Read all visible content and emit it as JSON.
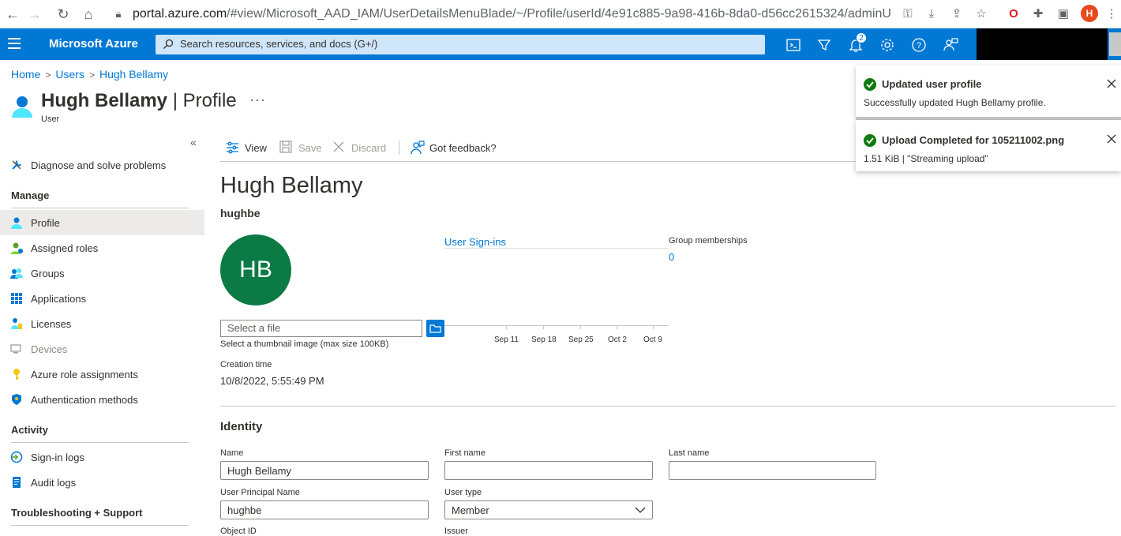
{
  "browser": {
    "url_host": "portal.azure.com",
    "url_path": "/#view/Microsoft_AAD_IAM/UserDetailsMenuBlade/~/Profile/userId/4e91c885-9a98-416b-8da0-d56cc2615324/adminUnitObj...",
    "profile_initial": "H"
  },
  "topbar": {
    "brand": "Microsoft Azure",
    "search_placeholder": "Search resources, services, and docs (G+/)",
    "notification_count": "2"
  },
  "breadcrumb": {
    "home": "Home",
    "users": "Users",
    "current": "Hugh Bellamy"
  },
  "header": {
    "title_bold": "Hugh Bellamy",
    "title_sep": " | ",
    "title_page": "Profile",
    "subtitle": "User",
    "more": "···"
  },
  "sidebar": {
    "collapse": "«",
    "diagnose": "Diagnose and solve problems",
    "manage_heading": "Manage",
    "manage_items": [
      "Profile",
      "Assigned roles",
      "Groups",
      "Applications",
      "Licenses",
      "Devices",
      "Azure role assignments",
      "Authentication methods"
    ],
    "activity_heading": "Activity",
    "activity_items": [
      "Sign-in logs",
      "Audit logs"
    ],
    "troubleshoot_heading": "Troubleshooting + Support"
  },
  "toolbar": {
    "view": "View",
    "save": "Save",
    "discard": "Discard",
    "feedback": "Got feedback?"
  },
  "profile": {
    "display_name": "Hugh Bellamy",
    "username": "hughbe",
    "initials": "HB",
    "file_placeholder": "Select a file",
    "file_hint": "Select a thumbnail image (max size 100KB)",
    "signins_link": "User Sign-ins",
    "group_memberships_label": "Group memberships",
    "group_memberships_value": "0",
    "chart_ticks": [
      "Sep 11",
      "Sep 18",
      "Sep 25",
      "Oct 2",
      "Oct 9"
    ],
    "creation_label": "Creation time",
    "creation_value": "10/8/2022, 5:55:49 PM"
  },
  "identity": {
    "heading": "Identity",
    "name_label": "Name",
    "name_value": "Hugh Bellamy",
    "first_label": "First name",
    "first_value": "",
    "last_label": "Last name",
    "last_value": "",
    "upn_label": "User Principal Name",
    "upn_value": "hughbe",
    "type_label": "User type",
    "type_value": "Member",
    "object_id_label": "Object ID",
    "issuer_label": "Issuer"
  },
  "toasts": [
    {
      "title": "Updated user profile",
      "message": "Successfully updated Hugh Bellamy profile."
    },
    {
      "title": "Upload Completed for 105211002.png",
      "message": "1.51 KiB | \"Streaming upload\""
    }
  ],
  "colors": {
    "azure_blue": "#0078d4",
    "avatar_green": "#0b7a45",
    "success_green": "#107c10"
  }
}
